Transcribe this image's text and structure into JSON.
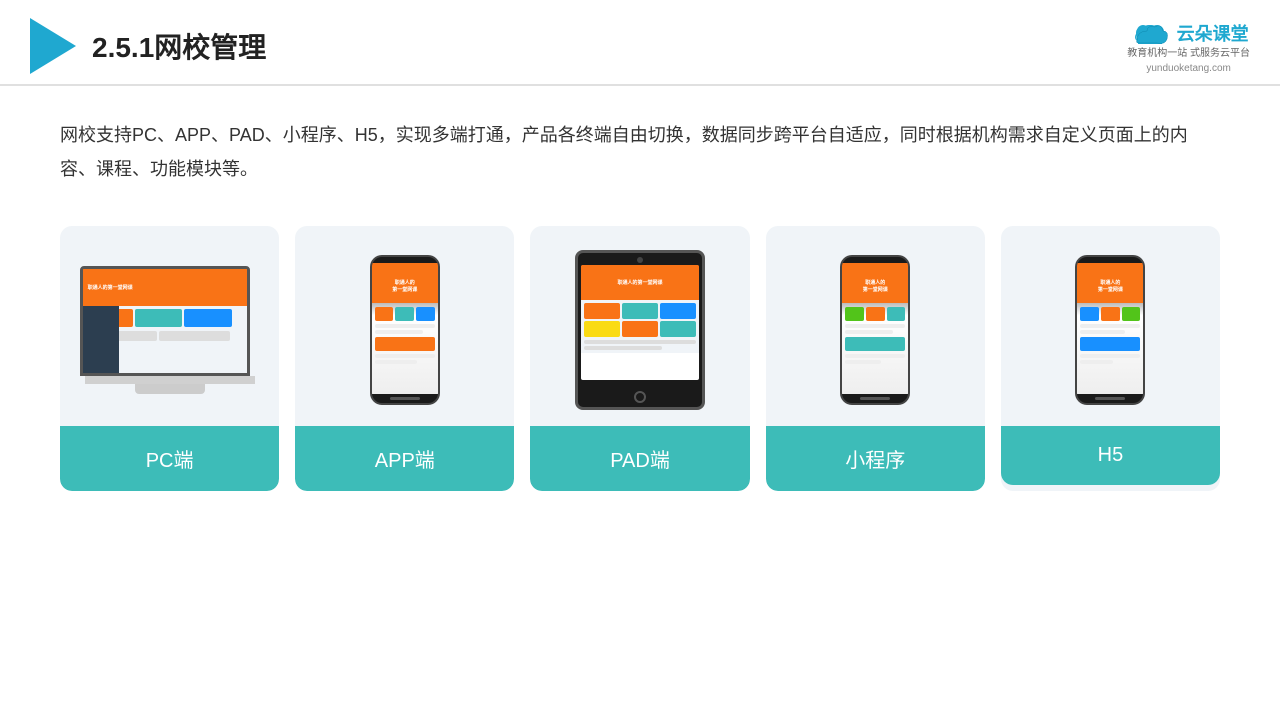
{
  "header": {
    "title": "2.5.1网校管理",
    "brand": {
      "name": "云朵课堂",
      "url": "yunduoketang.com",
      "tagline": "教育机构一站\n式服务云平台"
    }
  },
  "description": "网校支持PC、APP、PAD、小程序、H5，实现多端打通，产品各终端自由切换，数据同步跨平台自适应，同时根据机构需求自定义页面上的内容、课程、功能模块等。",
  "cards": [
    {
      "id": "pc",
      "label": "PC端",
      "type": "pc"
    },
    {
      "id": "app",
      "label": "APP端",
      "type": "phone"
    },
    {
      "id": "pad",
      "label": "PAD端",
      "type": "tablet"
    },
    {
      "id": "miniprogram",
      "label": "小程序",
      "type": "phone2"
    },
    {
      "id": "h5",
      "label": "H5",
      "type": "phone3"
    }
  ],
  "colors": {
    "accent": "#3dbcb8",
    "header_line": "#e0e0e0",
    "text": "#333333",
    "brand": "#1fa8d0"
  }
}
